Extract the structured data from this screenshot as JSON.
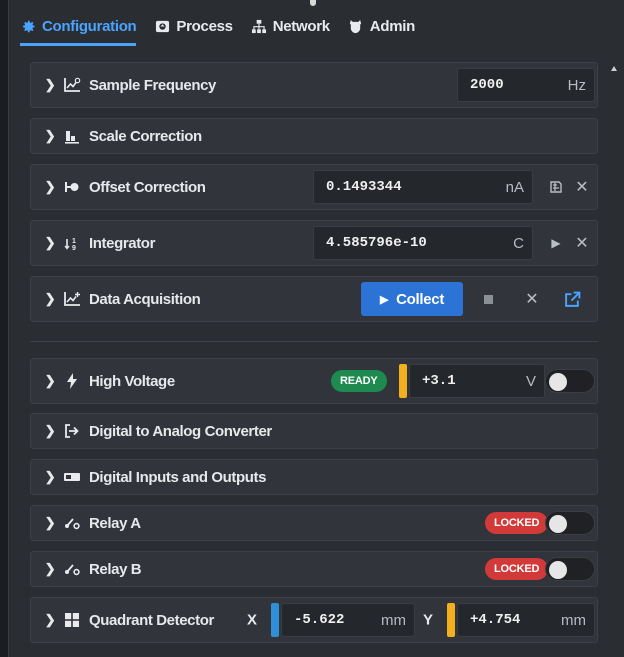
{
  "tabs": [
    {
      "label": "Configuration",
      "icon": "gear-icon",
      "active": true
    },
    {
      "label": "Process",
      "icon": "process-icon",
      "active": false
    },
    {
      "label": "Network",
      "icon": "network-icon",
      "active": false
    },
    {
      "label": "Admin",
      "icon": "admin-icon",
      "active": false
    }
  ],
  "colors": {
    "accent": "#4aa3ff",
    "collect_button": "#2b74d6",
    "ready_badge": "#1e8a4f",
    "locked_badge": "#d23a3a",
    "bar_yellow": "#f2b01e",
    "bar_blue": "#2f8fd8"
  },
  "rows": {
    "sample_frequency": {
      "label": "Sample Frequency",
      "value": "2000",
      "unit": "Hz"
    },
    "scale_correction": {
      "label": "Scale Correction"
    },
    "offset_correction": {
      "label": "Offset Correction",
      "value": "0.1493344",
      "unit": "nA"
    },
    "integrator": {
      "label": "Integrator",
      "value": "4.585796e-10",
      "unit": "C"
    },
    "data_acquisition": {
      "label": "Data Acquisition",
      "collect_label": "Collect"
    },
    "high_voltage": {
      "label": "High Voltage",
      "badge": "READY",
      "value": "+3.1",
      "unit": "V"
    },
    "dac": {
      "label": "Digital to Analog Converter"
    },
    "dio": {
      "label": "Digital Inputs and Outputs"
    },
    "relay_a": {
      "label": "Relay A",
      "badge": "LOCKED"
    },
    "relay_b": {
      "label": "Relay B",
      "badge": "LOCKED"
    },
    "quadrant": {
      "label": "Quadrant Detector",
      "x_label": "X",
      "x_value": "-5.622",
      "x_unit": "mm",
      "y_label": "Y",
      "y_value": "+4.754",
      "y_unit": "mm"
    }
  }
}
